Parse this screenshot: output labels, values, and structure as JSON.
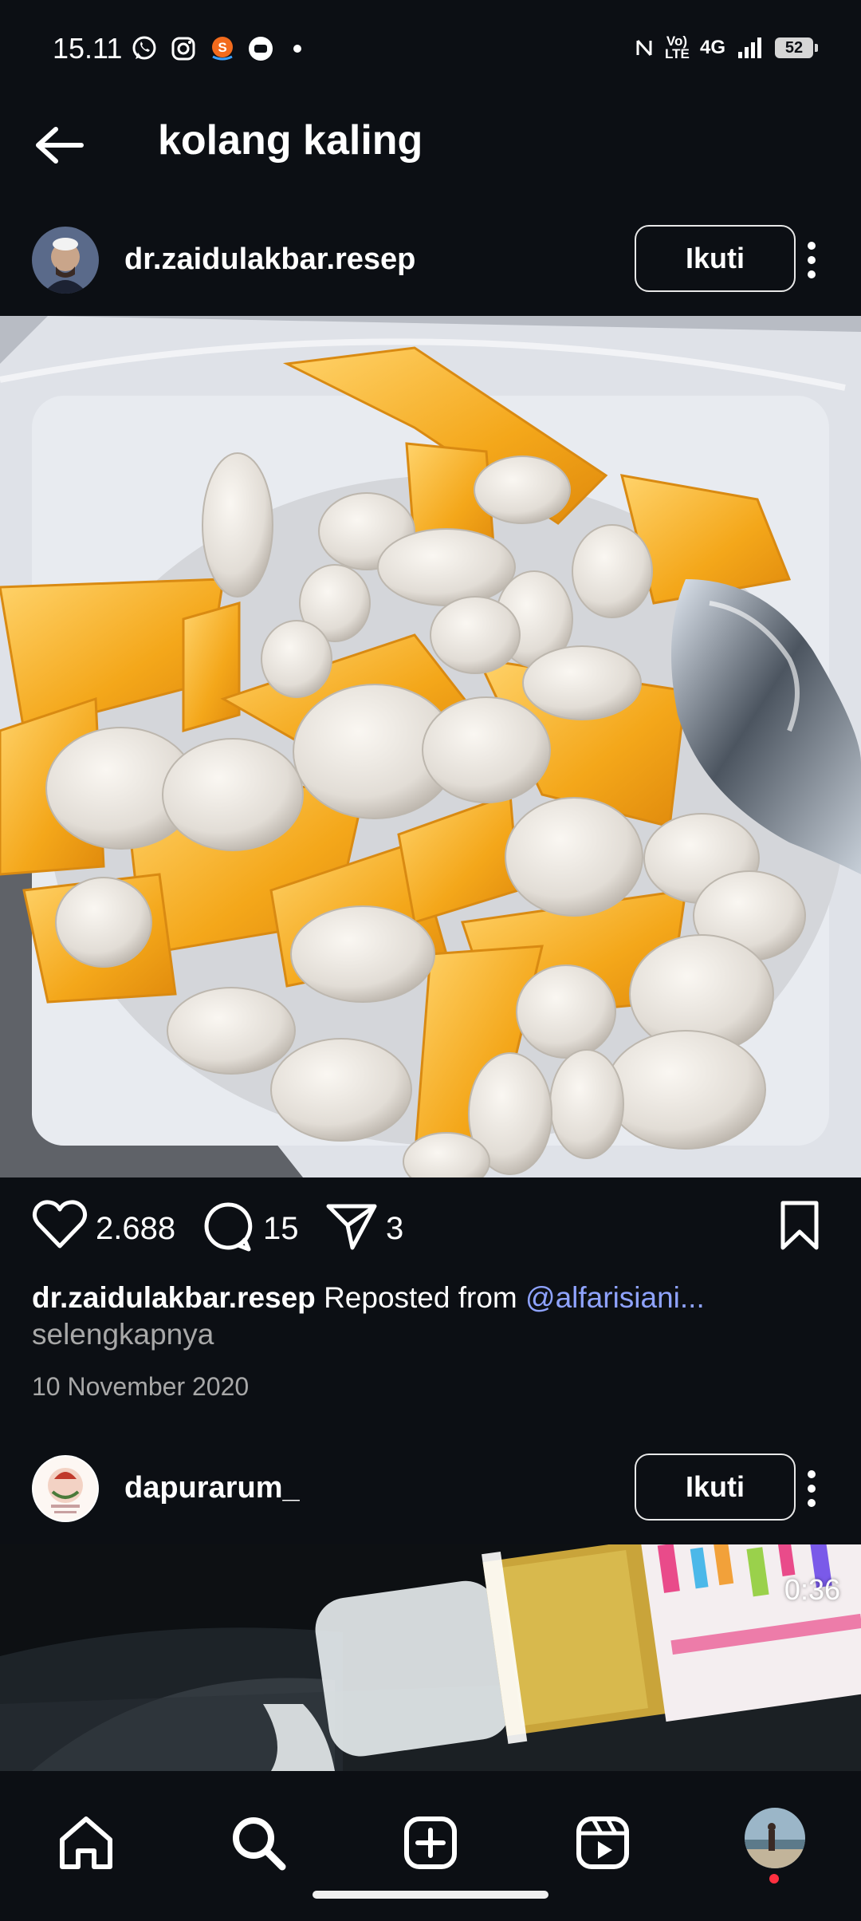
{
  "status_bar": {
    "time": "15.11",
    "left_icons": [
      "whatsapp-icon",
      "instagram-icon",
      "shopee-icon",
      "chat-icon",
      "dot-icon"
    ],
    "right_icons": [
      "nfc-icon",
      "volte-icon",
      "4g-icon",
      "signal-icon"
    ],
    "volte": "Vo) LTE",
    "network": "4G",
    "battery": "52"
  },
  "header": {
    "title": "kolang kaling"
  },
  "posts": [
    {
      "username": "dr.zaidulakbar.resep",
      "follow_label": "Ikuti",
      "likes": "2.688",
      "comments": "15",
      "shares": "3",
      "caption_user": "dr.zaidulakbar.resep",
      "caption_text": " Reposted from ",
      "caption_mention": "@alfarisiani...",
      "more_label": "selengkapnya",
      "date": "10 November 2020"
    },
    {
      "username": "dapurarum_",
      "follow_label": "Ikuti",
      "duration": "0:36"
    }
  ],
  "bottom_nav": {
    "items": [
      "home-icon",
      "search-icon",
      "create-icon",
      "reels-icon",
      "profile-avatar"
    ]
  },
  "colors": {
    "background": "#0c0f14",
    "mention": "#8fa3ff",
    "secondary_text": "#a8a8a8",
    "notification_dot": "#ff3040"
  }
}
